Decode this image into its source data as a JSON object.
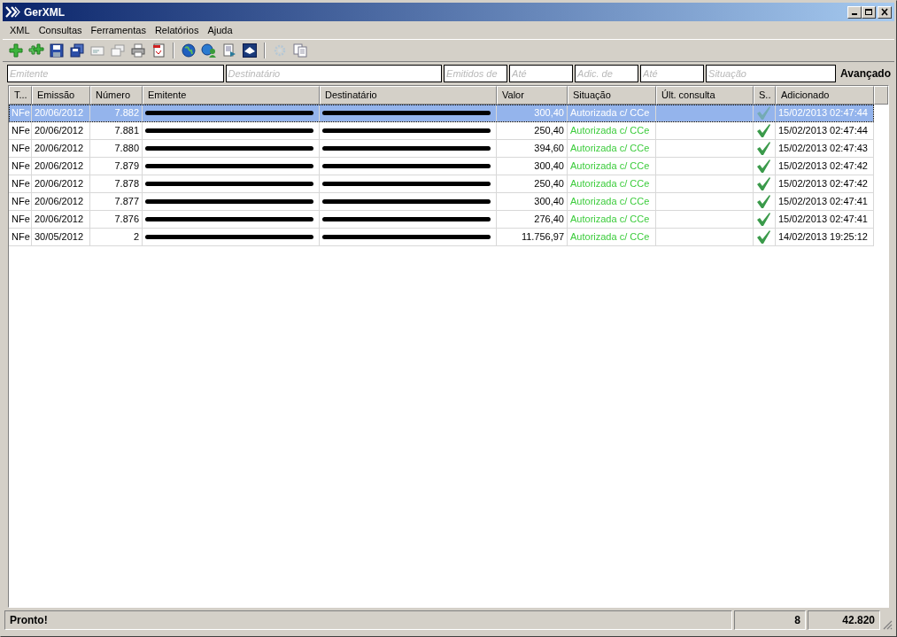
{
  "window": {
    "title": "GerXML"
  },
  "menu": [
    "XML",
    "Consultas",
    "Ferramentas",
    "Relatórios",
    "Ajuda"
  ],
  "toolbar": [
    {
      "kind": "add"
    },
    {
      "kind": "add-multi"
    },
    {
      "kind": "save"
    },
    {
      "kind": "save-all"
    },
    {
      "kind": "mail"
    },
    {
      "kind": "mail-multi"
    },
    {
      "kind": "print"
    },
    {
      "kind": "pdf"
    },
    {
      "kind": "separator"
    },
    {
      "kind": "globe"
    },
    {
      "kind": "globe-user"
    },
    {
      "kind": "document"
    },
    {
      "kind": "logo"
    },
    {
      "kind": "separator"
    },
    {
      "kind": "gear",
      "disabled": true
    },
    {
      "kind": "copy"
    }
  ],
  "filters": [
    {
      "placeholder": "Emitente"
    },
    {
      "placeholder": "Destinatário"
    },
    {
      "placeholder": "Emitidos de"
    },
    {
      "placeholder": "Até"
    },
    {
      "placeholder": "Adic. de"
    },
    {
      "placeholder": "Até"
    },
    {
      "placeholder": "Situação"
    }
  ],
  "advanced_label": "Avançado",
  "table": {
    "columns": [
      "T...",
      "Emissão",
      "Número",
      "Emitente",
      "Destinatário",
      "Valor",
      "Situação",
      "Últ. consulta",
      "S..",
      "Adicionado"
    ],
    "rows": [
      {
        "tipo": "NFe",
        "emissao": "20/06/2012",
        "numero": "7.882",
        "valor": "300,40",
        "situacao": "Autorizada c/ CCe",
        "checked": true,
        "adicionado": "15/02/2013 02:47:44",
        "selected": true
      },
      {
        "tipo": "NFe",
        "emissao": "20/06/2012",
        "numero": "7.881",
        "valor": "250,40",
        "situacao": "Autorizada c/ CCe",
        "checked": true,
        "adicionado": "15/02/2013 02:47:44",
        "selected": false
      },
      {
        "tipo": "NFe",
        "emissao": "20/06/2012",
        "numero": "7.880",
        "valor": "394,60",
        "situacao": "Autorizada c/ CCe",
        "checked": true,
        "adicionado": "15/02/2013 02:47:43",
        "selected": false
      },
      {
        "tipo": "NFe",
        "emissao": "20/06/2012",
        "numero": "7.879",
        "valor": "300,40",
        "situacao": "Autorizada c/ CCe",
        "checked": true,
        "adicionado": "15/02/2013 02:47:42",
        "selected": false
      },
      {
        "tipo": "NFe",
        "emissao": "20/06/2012",
        "numero": "7.878",
        "valor": "250,40",
        "situacao": "Autorizada c/ CCe",
        "checked": true,
        "adicionado": "15/02/2013 02:47:42",
        "selected": false
      },
      {
        "tipo": "NFe",
        "emissao": "20/06/2012",
        "numero": "7.877",
        "valor": "300,40",
        "situacao": "Autorizada c/ CCe",
        "checked": true,
        "adicionado": "15/02/2013 02:47:41",
        "selected": false
      },
      {
        "tipo": "NFe",
        "emissao": "20/06/2012",
        "numero": "7.876",
        "valor": "276,40",
        "situacao": "Autorizada c/ CCe",
        "checked": true,
        "adicionado": "15/02/2013 02:47:41",
        "selected": false
      },
      {
        "tipo": "NFe",
        "emissao": "30/05/2012",
        "numero": "2",
        "valor": "11.756,97",
        "situacao": "Autorizada c/ CCe",
        "checked": true,
        "adicionado": "14/02/2013 19:25:12",
        "selected": false
      }
    ]
  },
  "status_bar": {
    "message": "Pronto!",
    "count": "8",
    "total": "42.820"
  }
}
